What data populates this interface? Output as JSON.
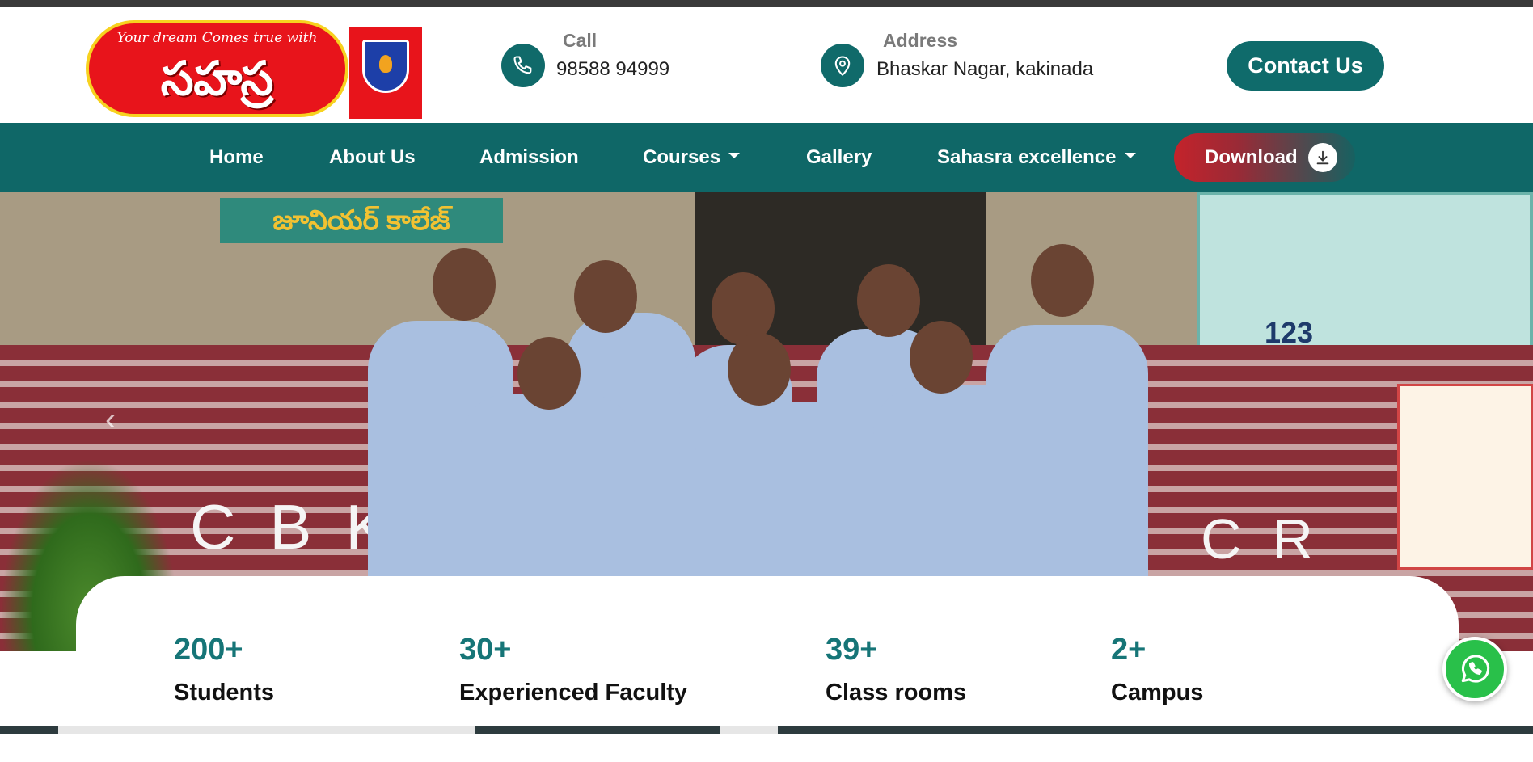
{
  "header": {
    "logo": {
      "tagline": "Your dream Comes true with",
      "brand": "సహస్ర",
      "crest_text": "సహస్ర"
    },
    "call": {
      "label": "Call",
      "value": "98588 94999",
      "icon": "phone-icon"
    },
    "address": {
      "label": "Address",
      "value": "Bhaskar Nagar, kakinada",
      "icon": "map-pin-icon"
    },
    "contact_button": "Contact Us"
  },
  "nav": {
    "items": [
      {
        "label": "Home"
      },
      {
        "label": "About Us"
      },
      {
        "label": "Admission"
      },
      {
        "label": "Courses",
        "dropdown": true
      },
      {
        "label": "Gallery"
      },
      {
        "label": "Sahasra excellence",
        "dropdown": true
      }
    ],
    "download": {
      "label": "Download",
      "icon": "download-icon"
    }
  },
  "hero": {
    "sign_text": "జూనియర్ కాలేజ్",
    "board_text": "123",
    "fence_letters_left": "CBK",
    "fence_letters_right": "CR",
    "prev_icon": "chevron-left-icon"
  },
  "stats": [
    {
      "number": "200+",
      "label": "Students"
    },
    {
      "number": "30+",
      "label": "Experienced Faculty"
    },
    {
      "number": "39+",
      "label": "Class rooms"
    },
    {
      "number": "2+",
      "label": "Campus"
    }
  ],
  "whatsapp": {
    "icon": "whatsapp-icon"
  },
  "colors": {
    "brand_teal": "#0f6767",
    "logo_red": "#e8141b",
    "download_red": "#c4232b",
    "whatsapp_green": "#29c04a"
  }
}
